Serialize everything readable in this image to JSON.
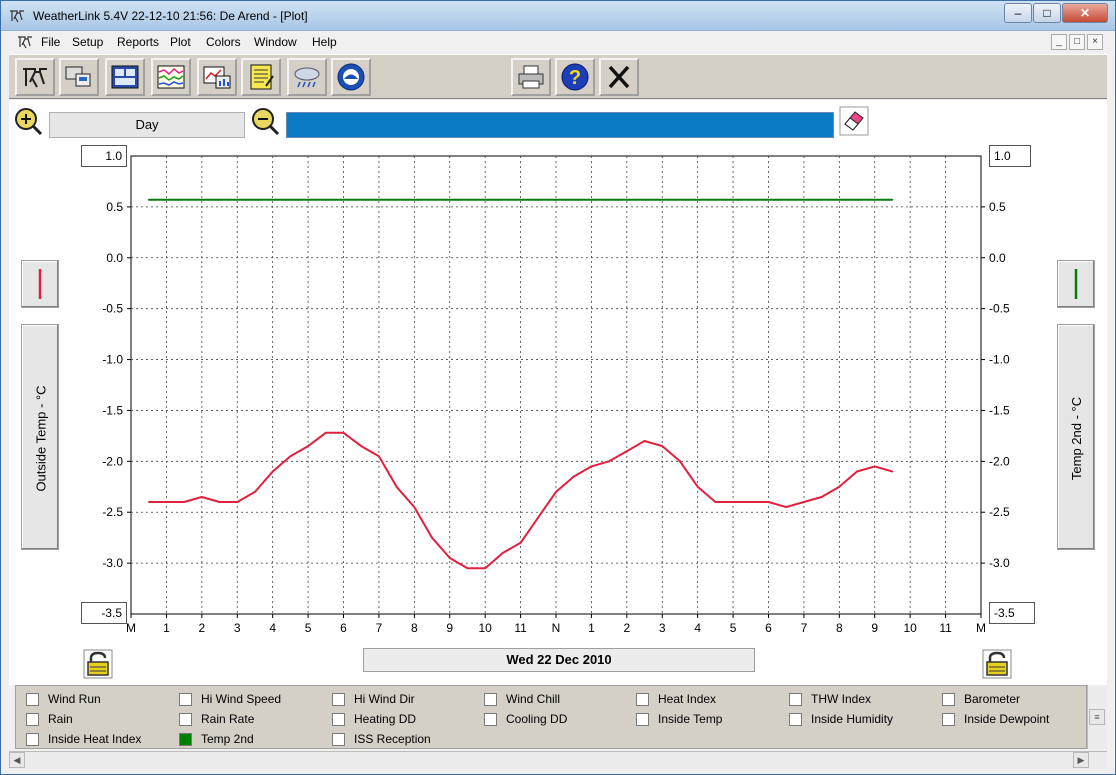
{
  "window": {
    "title": "WeatherLink 5.4V  22-12-10  21:56: De Arend - [Plot]",
    "minimize": "–",
    "maximize": "□",
    "close": "✕"
  },
  "menu": [
    "File",
    "Setup",
    "Reports",
    "Plot",
    "Colors",
    "Window",
    "Help"
  ],
  "mdi_controls": [
    "_",
    "□",
    "×"
  ],
  "toolbar_icons": [
    "station-status-icon",
    "bulletin-icon",
    "summary-icon",
    "strip-chart-icon",
    "graph-icon",
    "noaa-report-icon",
    "weather-icon",
    "noaa-logo-icon",
    "printer-icon",
    "help-icon",
    "close-x-icon"
  ],
  "plot": {
    "period_label": "Day",
    "date_label": "Wed 22 Dec 2010",
    "left_axis_title": "Outside Temp - °C",
    "right_axis_title": "Temp 2nd - °C",
    "left_top_box": "1.0",
    "left_bottom_box": "-3.5",
    "right_top_box": "1.0",
    "right_bottom_box": "-3.5",
    "left_series_color": "#e0213e",
    "right_series_color": "#0a7a0a"
  },
  "legend": [
    {
      "label": "Wind Run",
      "checked": false
    },
    {
      "label": "Hi Wind Speed",
      "checked": false
    },
    {
      "label": "Hi Wind Dir",
      "checked": false
    },
    {
      "label": "Wind Chill",
      "checked": false
    },
    {
      "label": "Heat Index",
      "checked": false
    },
    {
      "label": "THW Index",
      "checked": false
    },
    {
      "label": "Barometer",
      "checked": false
    },
    {
      "label": "Rain",
      "checked": false
    },
    {
      "label": "Rain Rate",
      "checked": false
    },
    {
      "label": "Heating DD",
      "checked": false
    },
    {
      "label": "Cooling DD",
      "checked": false
    },
    {
      "label": "Inside Temp",
      "checked": false
    },
    {
      "label": "Inside Humidity",
      "checked": false
    },
    {
      "label": "Inside Dewpoint",
      "checked": false
    },
    {
      "label": "Inside Heat Index",
      "checked": false
    },
    {
      "label": "Temp 2nd",
      "checked": true
    },
    {
      "label": "ISS Reception",
      "checked": false
    }
  ],
  "chart_data": {
    "type": "line",
    "x_tick_labels": [
      "M",
      "1",
      "2",
      "3",
      "4",
      "5",
      "6",
      "7",
      "8",
      "9",
      "10",
      "11",
      "N",
      "1",
      "2",
      "3",
      "4",
      "5",
      "6",
      "7",
      "8",
      "9",
      "10",
      "11",
      "M"
    ],
    "y_tick_labels": [
      "0.5",
      "0.0",
      "-0.5",
      "-1.0",
      "-1.5",
      "-2.0",
      "-2.5",
      "-3.0"
    ],
    "ylim": [
      -3.5,
      1.0
    ],
    "xlim": [
      0,
      24
    ],
    "grid": true,
    "series": [
      {
        "name": "Outside Temp - °C",
        "color": "#e0213e",
        "x": [
          0.5,
          1.0,
          1.5,
          2.0,
          2.5,
          3.0,
          3.5,
          4.0,
          4.5,
          5.0,
          5.5,
          6.0,
          6.5,
          7.0,
          7.5,
          8.0,
          8.5,
          9.0,
          9.5,
          10.0,
          10.5,
          11.0,
          11.5,
          12.0,
          12.5,
          13.0,
          13.5,
          14.0,
          14.5,
          15.0,
          15.5,
          16.0,
          16.5,
          17.0,
          17.5,
          18.0,
          18.5,
          19.0,
          19.5,
          20.0,
          20.5,
          21.0,
          21.5
        ],
        "y": [
          -2.4,
          -2.4,
          -2.4,
          -2.35,
          -2.4,
          -2.4,
          -2.3,
          -2.1,
          -1.95,
          -1.85,
          -1.72,
          -1.72,
          -1.85,
          -1.95,
          -2.25,
          -2.45,
          -2.75,
          -2.95,
          -3.05,
          -3.05,
          -2.9,
          -2.8,
          -2.55,
          -2.3,
          -2.15,
          -2.05,
          -2.0,
          -1.9,
          -1.8,
          -1.85,
          -2.0,
          -2.25,
          -2.4,
          -2.4,
          -2.4,
          -2.4,
          -2.45,
          -2.4,
          -2.35,
          -2.25,
          -2.1,
          -2.05,
          -2.1
        ]
      },
      {
        "name": "Temp 2nd - °C",
        "color": "#0a7a0a",
        "x": [
          0.5,
          21.5
        ],
        "y": [
          0.57,
          0.57
        ]
      }
    ]
  }
}
